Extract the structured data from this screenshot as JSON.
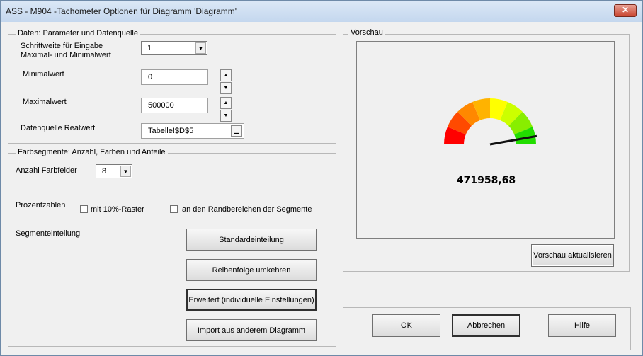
{
  "window": {
    "title": "ASS - M904 -Tachometer Optionen für Diagramm 'Diagramm'",
    "close_glyph": "✕"
  },
  "data_group": {
    "title": "Daten: Parameter und Datenquelle",
    "step_label_line1": "Schrittweite für Eingabe",
    "step_label_line2": "Maximal- und Minimalwert",
    "step_value": "1",
    "min_label": "Minimalwert",
    "min_value": "0",
    "max_label": "Maximalwert",
    "max_value": "500000",
    "source_label": "Datenquelle Realwert",
    "source_value": "Tabelle!$D$5"
  },
  "color_group": {
    "title": "Farbsegmente: Anzahl, Farben und Anteile",
    "count_label": "Anzahl Farbfelder",
    "count_value": "8",
    "percent_label": "Prozentzahlen",
    "check_raster_label": "mit 10%-Raster",
    "check_raster_checked": false,
    "check_edges_label": "an den Randbereichen der Segmente",
    "check_edges_checked": false,
    "segment_label": "Segmenteinteilung",
    "btn_standard": "Standardeinteilung",
    "btn_reverse": "Reihenfolge umkehren",
    "btn_extended": "Erweitert (individuelle Einstellungen)",
    "btn_import": "Import aus anderem Diagramm"
  },
  "preview": {
    "title": "Vorschau",
    "value_text": "471958,68",
    "value": 471958.68,
    "min": 0,
    "max": 500000,
    "segment_colors": [
      "#ff0000",
      "#ff4a00",
      "#ff8800",
      "#ffb300",
      "#ffff00",
      "#ccff00",
      "#88ee00",
      "#22dd00"
    ],
    "btn_refresh": "Vorschau aktualisieren"
  },
  "footer": {
    "ok": "OK",
    "cancel": "Abbrechen",
    "help": "Hilfe"
  }
}
